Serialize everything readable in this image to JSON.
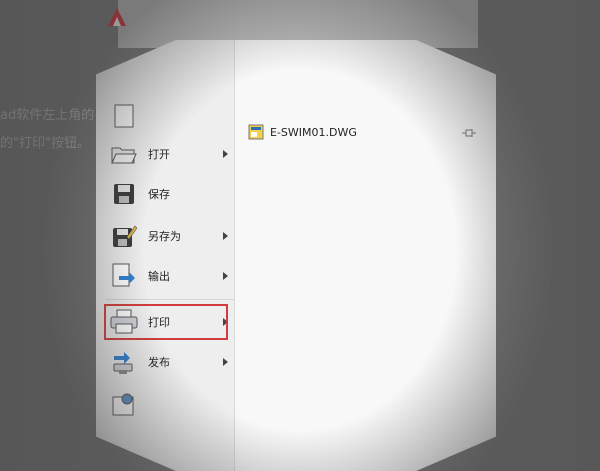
{
  "background": {
    "line1": "ad软件左上角的",
    "line2": "的\"打印\"按钮。"
  },
  "menu": {
    "items": [
      {
        "label": "打开",
        "icon": "folder-open-icon"
      },
      {
        "label": "保存",
        "icon": "floppy-disk-icon"
      },
      {
        "label": "另存为",
        "icon": "save-as-icon"
      },
      {
        "label": "输出",
        "icon": "export-icon"
      },
      {
        "label": "打印",
        "icon": "printer-icon"
      },
      {
        "label": "发布",
        "icon": "publish-icon"
      }
    ]
  },
  "recent": {
    "file_name": "E-SWIM01.DWG"
  },
  "colors": {
    "highlight": "#d23c3c",
    "menu_bg": "#f4f4f4"
  }
}
